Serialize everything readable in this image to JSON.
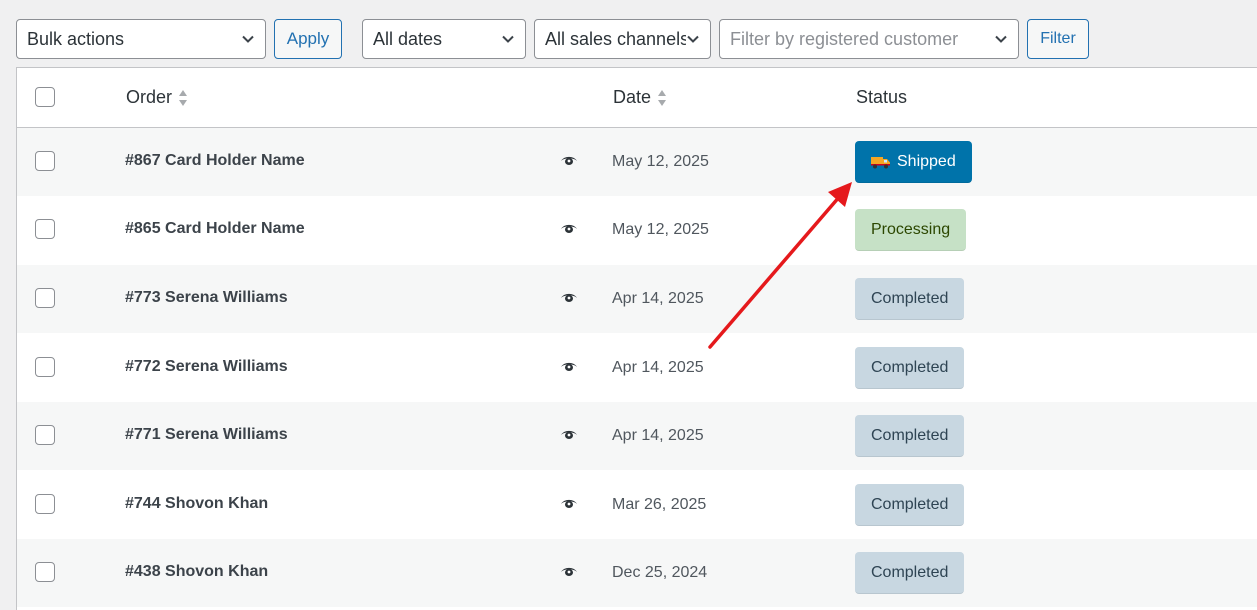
{
  "toolbar": {
    "bulk_actions": "Bulk actions",
    "apply": "Apply",
    "dates": "All dates",
    "channels": "All sales channels",
    "customer_placeholder": "Filter by registered customer",
    "filter": "Filter"
  },
  "table": {
    "headers": {
      "order": "Order",
      "date": "Date",
      "status": "Status"
    },
    "rows": [
      {
        "order": "#867 Card Holder Name",
        "date": "May 12, 2025",
        "status": "Shipped",
        "status_type": "shipped"
      },
      {
        "order": "#865 Card Holder Name",
        "date": "May 12, 2025",
        "status": "Processing",
        "status_type": "processing"
      },
      {
        "order": "#773 Serena Williams",
        "date": "Apr 14, 2025",
        "status": "Completed",
        "status_type": "completed"
      },
      {
        "order": "#772 Serena Williams",
        "date": "Apr 14, 2025",
        "status": "Completed",
        "status_type": "completed"
      },
      {
        "order": "#771 Serena Williams",
        "date": "Apr 14, 2025",
        "status": "Completed",
        "status_type": "completed"
      },
      {
        "order": "#744 Shovon Khan",
        "date": "Mar 26, 2025",
        "status": "Completed",
        "status_type": "completed"
      },
      {
        "order": "#438 Shovon Khan",
        "date": "Dec 25, 2024",
        "status": "Completed",
        "status_type": "completed"
      }
    ]
  },
  "icons": {
    "dropdown": "chevron-down-icon",
    "sort": "sort-icon",
    "preview": "eye-icon",
    "shipped": "truck-icon"
  },
  "colors": {
    "accent": "#2271b1",
    "shipped": "#0073aa",
    "processing": "#c6e1c6",
    "completed": "#c8d7e1",
    "annotation_arrow": "#e5191c"
  }
}
